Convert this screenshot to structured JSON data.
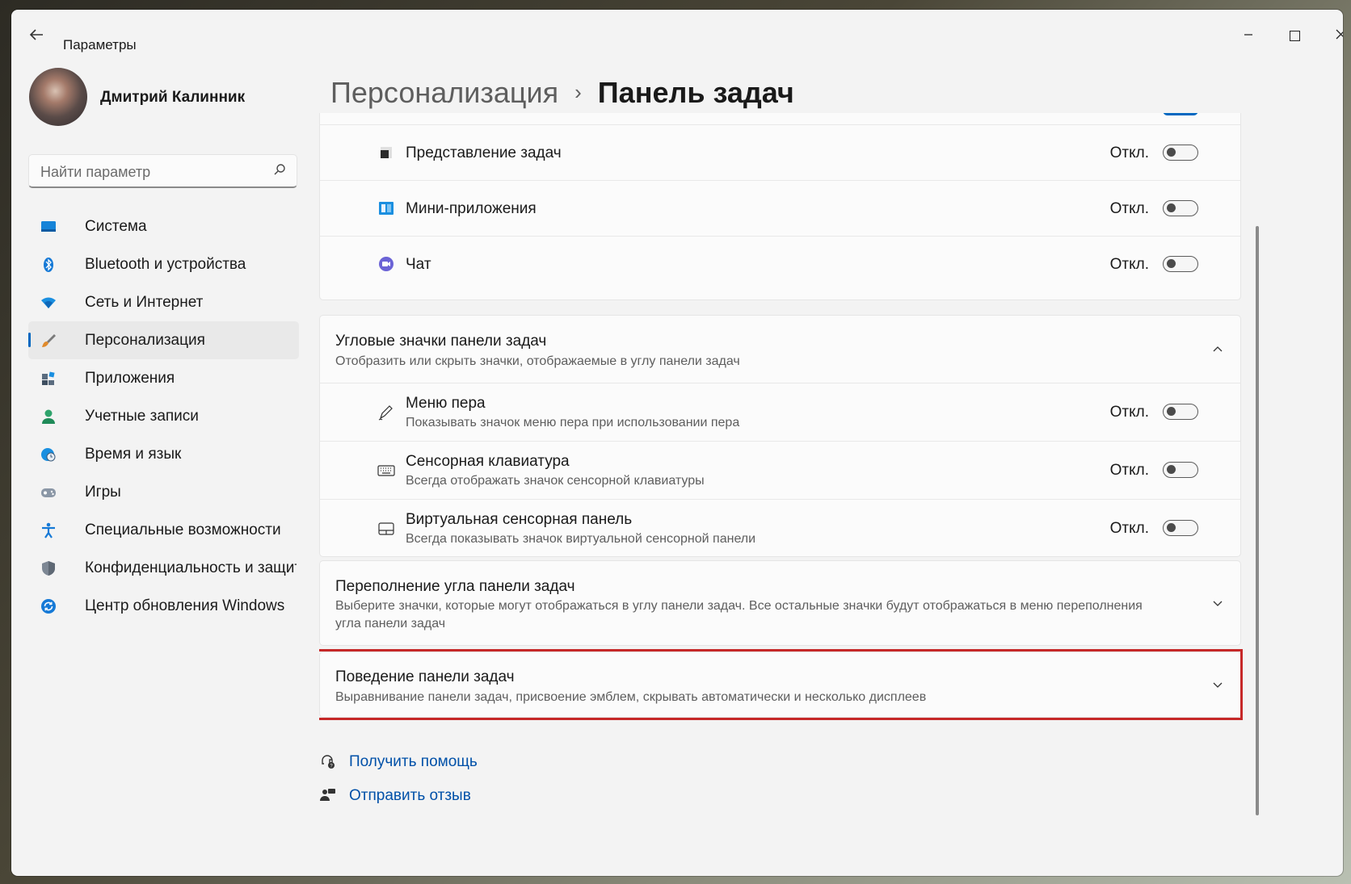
{
  "window": {
    "title": "Параметры"
  },
  "user": {
    "name": "Дмитрий Калинник"
  },
  "search": {
    "placeholder": "Найти параметр"
  },
  "nav": {
    "items": [
      {
        "label": "Система",
        "icon": "monitor-icon"
      },
      {
        "label": "Bluetooth и устройства",
        "icon": "bluetooth-icon"
      },
      {
        "label": "Сеть и Интернет",
        "icon": "wifi-icon"
      },
      {
        "label": "Персонализация",
        "icon": "brush-icon",
        "active": true
      },
      {
        "label": "Приложения",
        "icon": "apps-icon"
      },
      {
        "label": "Учетные записи",
        "icon": "person-icon"
      },
      {
        "label": "Время и язык",
        "icon": "globe-clock-icon"
      },
      {
        "label": "Игры",
        "icon": "gamepad-icon"
      },
      {
        "label": "Специальные возможности",
        "icon": "accessibility-icon"
      },
      {
        "label": "Конфиденциальность и защита",
        "icon": "shield-icon"
      },
      {
        "label": "Центр обновления Windows",
        "icon": "update-icon"
      }
    ]
  },
  "breadcrumb": {
    "parent": "Персонализация",
    "separator": "›",
    "current": "Панель задач"
  },
  "taskbar_items": [
    {
      "title": "Представление задач",
      "state": "Откл.",
      "icon": "task-view-icon"
    },
    {
      "title": "Мини-приложения",
      "state": "Откл.",
      "icon": "widgets-icon"
    },
    {
      "title": "Чат",
      "state": "Откл.",
      "icon": "chat-icon"
    }
  ],
  "corner_icons": {
    "title": "Угловые значки панели задач",
    "subtitle": "Отобразить или скрыть значки, отображаемые в углу панели задач",
    "items": [
      {
        "title": "Меню пера",
        "subtitle": "Показывать значок меню пера при использовании пера",
        "state": "Откл.",
        "icon": "pen-icon"
      },
      {
        "title": "Сенсорная клавиатура",
        "subtitle": "Всегда отображать значок сенсорной клавиатуры",
        "state": "Откл.",
        "icon": "keyboard-icon"
      },
      {
        "title": "Виртуальная сенсорная панель",
        "subtitle": "Всегда показывать значок виртуальной сенсорной панели",
        "state": "Откл.",
        "icon": "touchpad-icon"
      }
    ]
  },
  "overflow": {
    "title": "Переполнение угла панели задач",
    "subtitle": "Выберите значки, которые могут отображаться в углу панели задач. Все остальные значки будут отображаться в меню переполнения угла панели задач"
  },
  "behavior": {
    "title": "Поведение панели задач",
    "subtitle": "Выравнивание панели задач, присвоение эмблем, скрывать автоматически и несколько дисплеев"
  },
  "links": {
    "help": "Получить помощь",
    "feedback": "Отправить отзыв"
  },
  "colors": {
    "accent": "#0067c0",
    "link": "#0050a8",
    "highlight": "#c62828"
  }
}
